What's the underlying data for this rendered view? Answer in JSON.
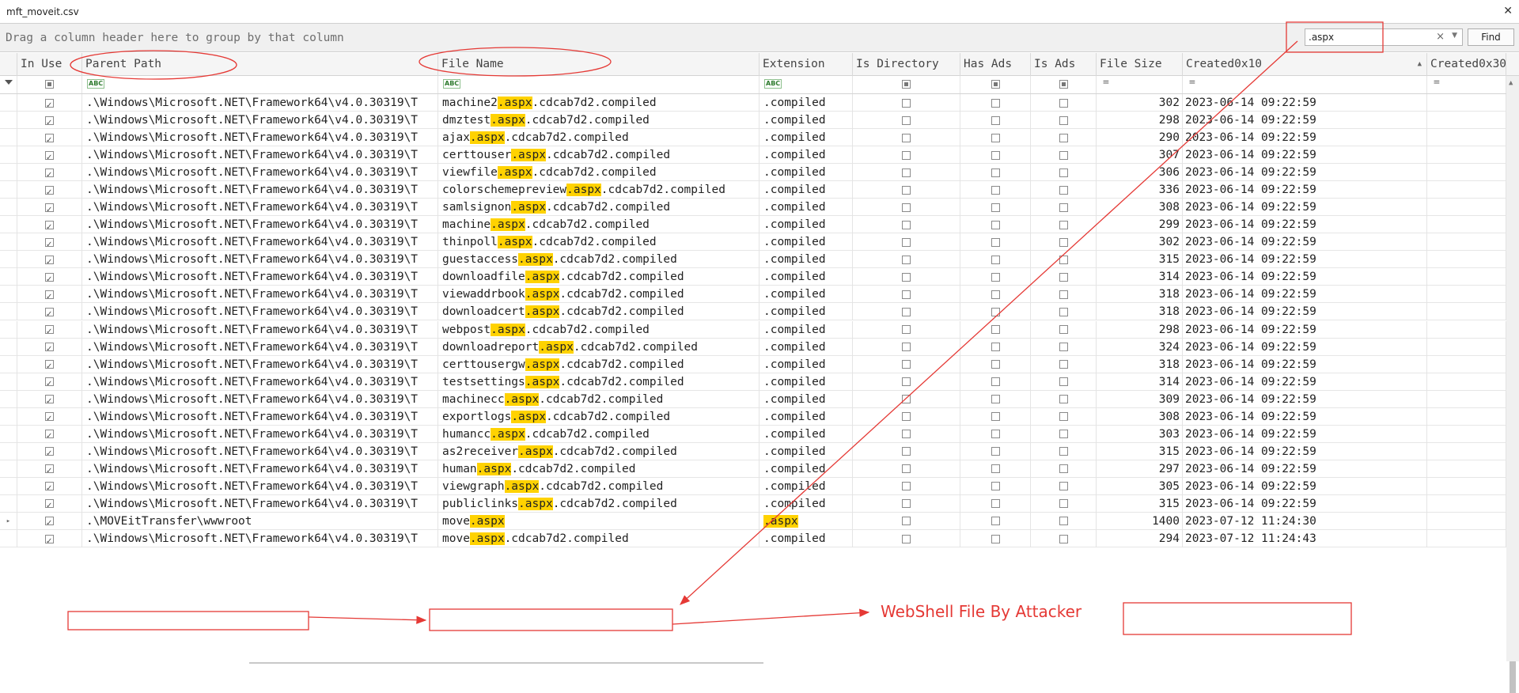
{
  "window": {
    "title": "mft_moveit.csv",
    "close_icon": "close-icon"
  },
  "group_panel": {
    "hint": "Drag a column header here to group by that column"
  },
  "find": {
    "value": ".aspx",
    "clear": "×",
    "button": "Find"
  },
  "columns": [
    "In Use",
    "Parent Path",
    "File Name",
    "Extension",
    "Is Directory",
    "Has Ads",
    "Is Ads",
    "File Size",
    "Created0x10",
    "Created0x30"
  ],
  "rows": [
    {
      "path": ".\\Windows\\Microsoft.NET\\Framework64\\v4.0.30319\\T",
      "pre": "machine2",
      "match": ".aspx",
      "post": ".cdcab7d2.compiled",
      "ext": ".compiled",
      "size": "302",
      "created": "2023-06-14 09:22:59"
    },
    {
      "path": ".\\Windows\\Microsoft.NET\\Framework64\\v4.0.30319\\T",
      "pre": "dmztest",
      "match": ".aspx",
      "post": ".cdcab7d2.compiled",
      "ext": ".compiled",
      "size": "298",
      "created": "2023-06-14 09:22:59"
    },
    {
      "path": ".\\Windows\\Microsoft.NET\\Framework64\\v4.0.30319\\T",
      "pre": "ajax",
      "match": ".aspx",
      "post": ".cdcab7d2.compiled",
      "ext": ".compiled",
      "size": "290",
      "created": "2023-06-14 09:22:59"
    },
    {
      "path": ".\\Windows\\Microsoft.NET\\Framework64\\v4.0.30319\\T",
      "pre": "certtouser",
      "match": ".aspx",
      "post": ".cdcab7d2.compiled",
      "ext": ".compiled",
      "size": "307",
      "created": "2023-06-14 09:22:59"
    },
    {
      "path": ".\\Windows\\Microsoft.NET\\Framework64\\v4.0.30319\\T",
      "pre": "viewfile",
      "match": ".aspx",
      "post": ".cdcab7d2.compiled",
      "ext": ".compiled",
      "size": "306",
      "created": "2023-06-14 09:22:59"
    },
    {
      "path": ".\\Windows\\Microsoft.NET\\Framework64\\v4.0.30319\\T",
      "pre": "colorschemepreview",
      "match": ".aspx",
      "post": ".cdcab7d2.compiled",
      "ext": ".compiled",
      "size": "336",
      "created": "2023-06-14 09:22:59"
    },
    {
      "path": ".\\Windows\\Microsoft.NET\\Framework64\\v4.0.30319\\T",
      "pre": "samlsignon",
      "match": ".aspx",
      "post": ".cdcab7d2.compiled",
      "ext": ".compiled",
      "size": "308",
      "created": "2023-06-14 09:22:59"
    },
    {
      "path": ".\\Windows\\Microsoft.NET\\Framework64\\v4.0.30319\\T",
      "pre": "machine",
      "match": ".aspx",
      "post": ".cdcab7d2.compiled",
      "ext": ".compiled",
      "size": "299",
      "created": "2023-06-14 09:22:59"
    },
    {
      "path": ".\\Windows\\Microsoft.NET\\Framework64\\v4.0.30319\\T",
      "pre": "thinpoll",
      "match": ".aspx",
      "post": ".cdcab7d2.compiled",
      "ext": ".compiled",
      "size": "302",
      "created": "2023-06-14 09:22:59"
    },
    {
      "path": ".\\Windows\\Microsoft.NET\\Framework64\\v4.0.30319\\T",
      "pre": "guestaccess",
      "match": ".aspx",
      "post": ".cdcab7d2.compiled",
      "ext": ".compiled",
      "size": "315",
      "created": "2023-06-14 09:22:59"
    },
    {
      "path": ".\\Windows\\Microsoft.NET\\Framework64\\v4.0.30319\\T",
      "pre": "downloadfile",
      "match": ".aspx",
      "post": ".cdcab7d2.compiled",
      "ext": ".compiled",
      "size": "314",
      "created": "2023-06-14 09:22:59"
    },
    {
      "path": ".\\Windows\\Microsoft.NET\\Framework64\\v4.0.30319\\T",
      "pre": "viewaddrbook",
      "match": ".aspx",
      "post": ".cdcab7d2.compiled",
      "ext": ".compiled",
      "size": "318",
      "created": "2023-06-14 09:22:59"
    },
    {
      "path": ".\\Windows\\Microsoft.NET\\Framework64\\v4.0.30319\\T",
      "pre": "downloadcert",
      "match": ".aspx",
      "post": ".cdcab7d2.compiled",
      "ext": ".compiled",
      "size": "318",
      "created": "2023-06-14 09:22:59"
    },
    {
      "path": ".\\Windows\\Microsoft.NET\\Framework64\\v4.0.30319\\T",
      "pre": "webpost",
      "match": ".aspx",
      "post": ".cdcab7d2.compiled",
      "ext": ".compiled",
      "size": "298",
      "created": "2023-06-14 09:22:59"
    },
    {
      "path": ".\\Windows\\Microsoft.NET\\Framework64\\v4.0.30319\\T",
      "pre": "downloadreport",
      "match": ".aspx",
      "post": ".cdcab7d2.compiled",
      "ext": ".compiled",
      "size": "324",
      "created": "2023-06-14 09:22:59"
    },
    {
      "path": ".\\Windows\\Microsoft.NET\\Framework64\\v4.0.30319\\T",
      "pre": "certtousergw",
      "match": ".aspx",
      "post": ".cdcab7d2.compiled",
      "ext": ".compiled",
      "size": "318",
      "created": "2023-06-14 09:22:59"
    },
    {
      "path": ".\\Windows\\Microsoft.NET\\Framework64\\v4.0.30319\\T",
      "pre": "testsettings",
      "match": ".aspx",
      "post": ".cdcab7d2.compiled",
      "ext": ".compiled",
      "size": "314",
      "created": "2023-06-14 09:22:59"
    },
    {
      "path": ".\\Windows\\Microsoft.NET\\Framework64\\v4.0.30319\\T",
      "pre": "machinecc",
      "match": ".aspx",
      "post": ".cdcab7d2.compiled",
      "ext": ".compiled",
      "size": "309",
      "created": "2023-06-14 09:22:59"
    },
    {
      "path": ".\\Windows\\Microsoft.NET\\Framework64\\v4.0.30319\\T",
      "pre": "exportlogs",
      "match": ".aspx",
      "post": ".cdcab7d2.compiled",
      "ext": ".compiled",
      "size": "308",
      "created": "2023-06-14 09:22:59"
    },
    {
      "path": ".\\Windows\\Microsoft.NET\\Framework64\\v4.0.30319\\T",
      "pre": "humancc",
      "match": ".aspx",
      "post": ".cdcab7d2.compiled",
      "ext": ".compiled",
      "size": "303",
      "created": "2023-06-14 09:22:59"
    },
    {
      "path": ".\\Windows\\Microsoft.NET\\Framework64\\v4.0.30319\\T",
      "pre": "as2receiver",
      "match": ".aspx",
      "post": ".cdcab7d2.compiled",
      "ext": ".compiled",
      "size": "315",
      "created": "2023-06-14 09:22:59"
    },
    {
      "path": ".\\Windows\\Microsoft.NET\\Framework64\\v4.0.30319\\T",
      "pre": "human",
      "match": ".aspx",
      "post": ".cdcab7d2.compiled",
      "ext": ".compiled",
      "size": "297",
      "created": "2023-06-14 09:22:59"
    },
    {
      "path": ".\\Windows\\Microsoft.NET\\Framework64\\v4.0.30319\\T",
      "pre": "viewgraph",
      "match": ".aspx",
      "post": ".cdcab7d2.compiled",
      "ext": ".compiled",
      "size": "305",
      "created": "2023-06-14 09:22:59"
    },
    {
      "path": ".\\Windows\\Microsoft.NET\\Framework64\\v4.0.30319\\T",
      "pre": "publiclinks",
      "match": ".aspx",
      "post": ".cdcab7d2.compiled",
      "ext": ".compiled",
      "size": "315",
      "created": "2023-06-14 09:22:59"
    },
    {
      "path": ".\\MOVEitTransfer\\wwwroot",
      "pre": "move",
      "match": ".aspx",
      "post": "",
      "ext": ".aspx",
      "ext_highlight": true,
      "size": "1400",
      "created": "2023-07-12 11:24:30",
      "current": true
    },
    {
      "path": ".\\Windows\\Microsoft.NET\\Framework64\\v4.0.30319\\T",
      "pre": "move",
      "match": ".aspx",
      "post": ".cdcab7d2.compiled",
      "ext": ".compiled",
      "size": "294",
      "created": "2023-07-12 11:24:43"
    }
  ],
  "annotation": {
    "label": "WebShell File By Attacker",
    "color": "#e53935"
  },
  "colors": {
    "highlight": "#ffd200",
    "annotation": "#e53935"
  }
}
